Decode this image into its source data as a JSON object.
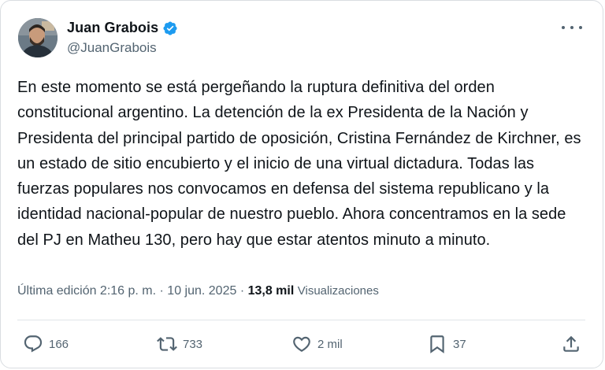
{
  "author": {
    "name": "Juan Grabois",
    "handle": "@JuanGrabois",
    "verified": true,
    "verified_color": "#1d9bf0",
    "avatar_icon": "profile-photo"
  },
  "tweet": {
    "text": "En este momento se está pergeñando la ruptura definitiva del orden constitucional argentino. La detención de la ex Presidenta de la Nación y Presidenta del principal partido de oposición, Cristina Fernández de Kirchner, es un estado de sitio encubierto y el inicio de una virtual dictadura. Todas las fuerzas populares nos convocamos en defensa del sistema republicano y la identidad nacional-popular de nuestro pueblo. Ahora concentramos en la sede del PJ en Matheu 130, pero hay que estar atentos minuto a minuto."
  },
  "meta": {
    "edited": "Última edición 2:16 p. m. · 10 jun. 2025 · ",
    "views_count": "13,8 mil",
    "views_label": "Visualizaciones"
  },
  "actions": {
    "reply": {
      "icon": "reply-icon",
      "count": "166"
    },
    "retweet": {
      "icon": "retweet-icon",
      "count": "733"
    },
    "like": {
      "icon": "heart-icon",
      "count": "2 mil"
    },
    "bookmark": {
      "icon": "bookmark-icon",
      "count": "37"
    },
    "share": {
      "icon": "share-icon"
    }
  },
  "colors": {
    "text_primary": "#0f1419",
    "text_secondary": "#536471",
    "border": "#d9dde1"
  }
}
